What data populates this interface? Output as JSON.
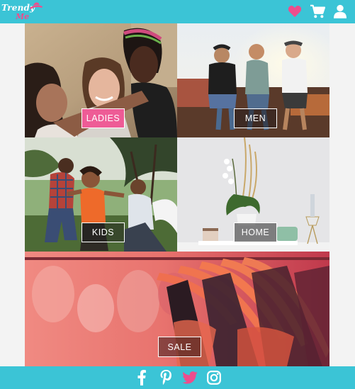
{
  "brand": {
    "logo_line1": "Trendy",
    "logo_line2": "Me",
    "color_primary": "#3bc4d6",
    "color_accent": "#ee4d8c"
  },
  "header": {
    "icons": [
      "heart-icon",
      "cart-icon",
      "user-icon"
    ]
  },
  "categories": [
    {
      "label": "LADIES",
      "image": "group-of-young-women-photo"
    },
    {
      "label": "MEN",
      "image": "group-of-young-men-photo"
    },
    {
      "label": "KIDS",
      "image": "children-playing-photo"
    },
    {
      "label": "HOME",
      "image": "home-decor-orchid-photo"
    },
    {
      "label": "SALE",
      "image": "clothes-rack-hangers-photo"
    }
  ],
  "footer": {
    "icons": [
      "facebook-icon",
      "pinterest-icon",
      "twitter-icon",
      "instagram-icon"
    ]
  }
}
